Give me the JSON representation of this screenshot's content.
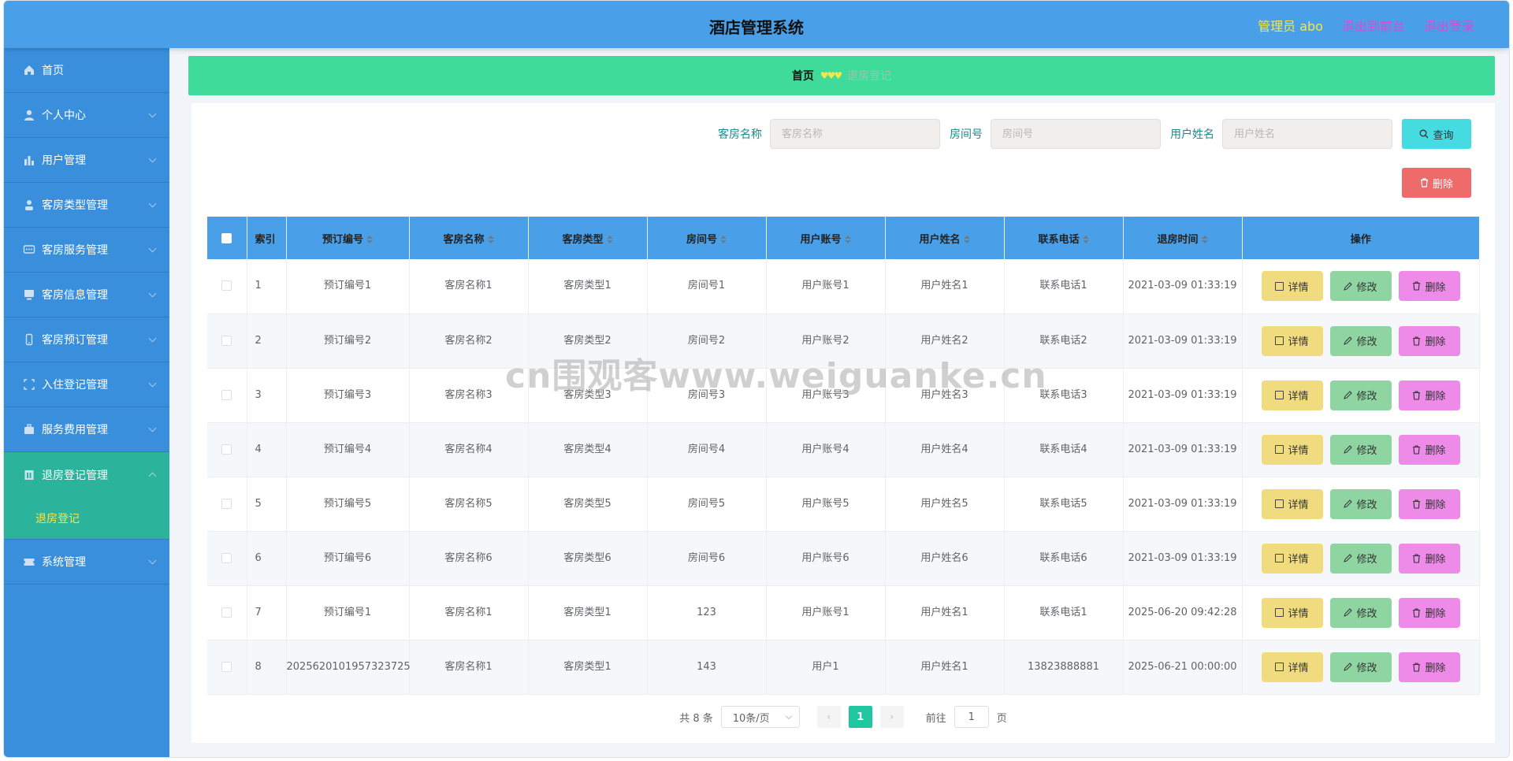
{
  "app": {
    "title": "酒店管理系统"
  },
  "header": {
    "admin": "管理员 abo",
    "back_front": "退出到前台",
    "logout": "退出登录"
  },
  "sidebar": {
    "items": [
      {
        "label": "首页",
        "icon": "home-icon"
      },
      {
        "label": "个人中心",
        "icon": "user-icon"
      },
      {
        "label": "用户管理",
        "icon": "chart-icon"
      },
      {
        "label": "客房类型管理",
        "icon": "person-icon"
      },
      {
        "label": "客房服务管理",
        "icon": "chat-icon"
      },
      {
        "label": "客房信息管理",
        "icon": "monitor-icon"
      },
      {
        "label": "客房预订管理",
        "icon": "phone-icon"
      },
      {
        "label": "入住登记管理",
        "icon": "fullscreen-icon"
      },
      {
        "label": "服务费用管理",
        "icon": "bag-icon"
      },
      {
        "label": "退房登记管理",
        "icon": "document-icon"
      },
      {
        "label": "系统管理",
        "icon": "ticket-icon"
      }
    ],
    "sub_item": "退房登记"
  },
  "breadcrumb": {
    "home": "首页",
    "sep": "♥♥♥",
    "current": "退房登记"
  },
  "search": {
    "room_name_label": "客房名称",
    "room_name_placeholder": "客房名称",
    "room_no_label": "房间号",
    "room_no_placeholder": "房间号",
    "user_name_label": "用户姓名",
    "user_name_placeholder": "用户姓名",
    "query_button": "查询",
    "delete_button": "删除"
  },
  "table": {
    "headers": [
      "索引",
      "预订编号",
      "客房名称",
      "客房类型",
      "房间号",
      "用户账号",
      "用户姓名",
      "联系电话",
      "退房时间",
      "操作"
    ],
    "rows": [
      [
        "1",
        "预订编号1",
        "客房名称1",
        "客房类型1",
        "房间号1",
        "用户账号1",
        "用户姓名1",
        "联系电话1",
        "2021-03-09 01:33:19"
      ],
      [
        "2",
        "预订编号2",
        "客房名称2",
        "客房类型2",
        "房间号2",
        "用户账号2",
        "用户姓名2",
        "联系电话2",
        "2021-03-09 01:33:19"
      ],
      [
        "3",
        "预订编号3",
        "客房名称3",
        "客房类型3",
        "房间号3",
        "用户账号3",
        "用户姓名3",
        "联系电话3",
        "2021-03-09 01:33:19"
      ],
      [
        "4",
        "预订编号4",
        "客房名称4",
        "客房类型4",
        "房间号4",
        "用户账号4",
        "用户姓名4",
        "联系电话4",
        "2021-03-09 01:33:19"
      ],
      [
        "5",
        "预订编号5",
        "客房名称5",
        "客房类型5",
        "房间号5",
        "用户账号5",
        "用户姓名5",
        "联系电话5",
        "2021-03-09 01:33:19"
      ],
      [
        "6",
        "预订编号6",
        "客房名称6",
        "客房类型6",
        "房间号6",
        "用户账号6",
        "用户姓名6",
        "联系电话6",
        "2021-03-09 01:33:19"
      ],
      [
        "7",
        "预订编号1",
        "客房名称1",
        "客房类型1",
        "123",
        "用户账号1",
        "用户姓名1",
        "联系电话1",
        "2025-06-20 09:42:28"
      ],
      [
        "8",
        "2025620101957323725",
        "客房名称1",
        "客房类型1",
        "143",
        "用户1",
        "用户姓名1",
        "13823888881",
        "2025-06-21 00:00:00"
      ]
    ],
    "actions": {
      "detail": "详情",
      "edit": "修改",
      "delete": "删除"
    }
  },
  "pagination": {
    "total": "共 8 条",
    "page_size": "10条/页",
    "current": "1",
    "goto_prefix": "前往",
    "goto_value": "1",
    "goto_suffix": "页"
  },
  "watermark": "cn围观客www.weiguanke.cn",
  "colors": {
    "header": "#4aa0e8",
    "sidebar": "#3a8fdc",
    "active_menu": "#2bb39b",
    "breadcrumb": "#3fdb9a"
  }
}
